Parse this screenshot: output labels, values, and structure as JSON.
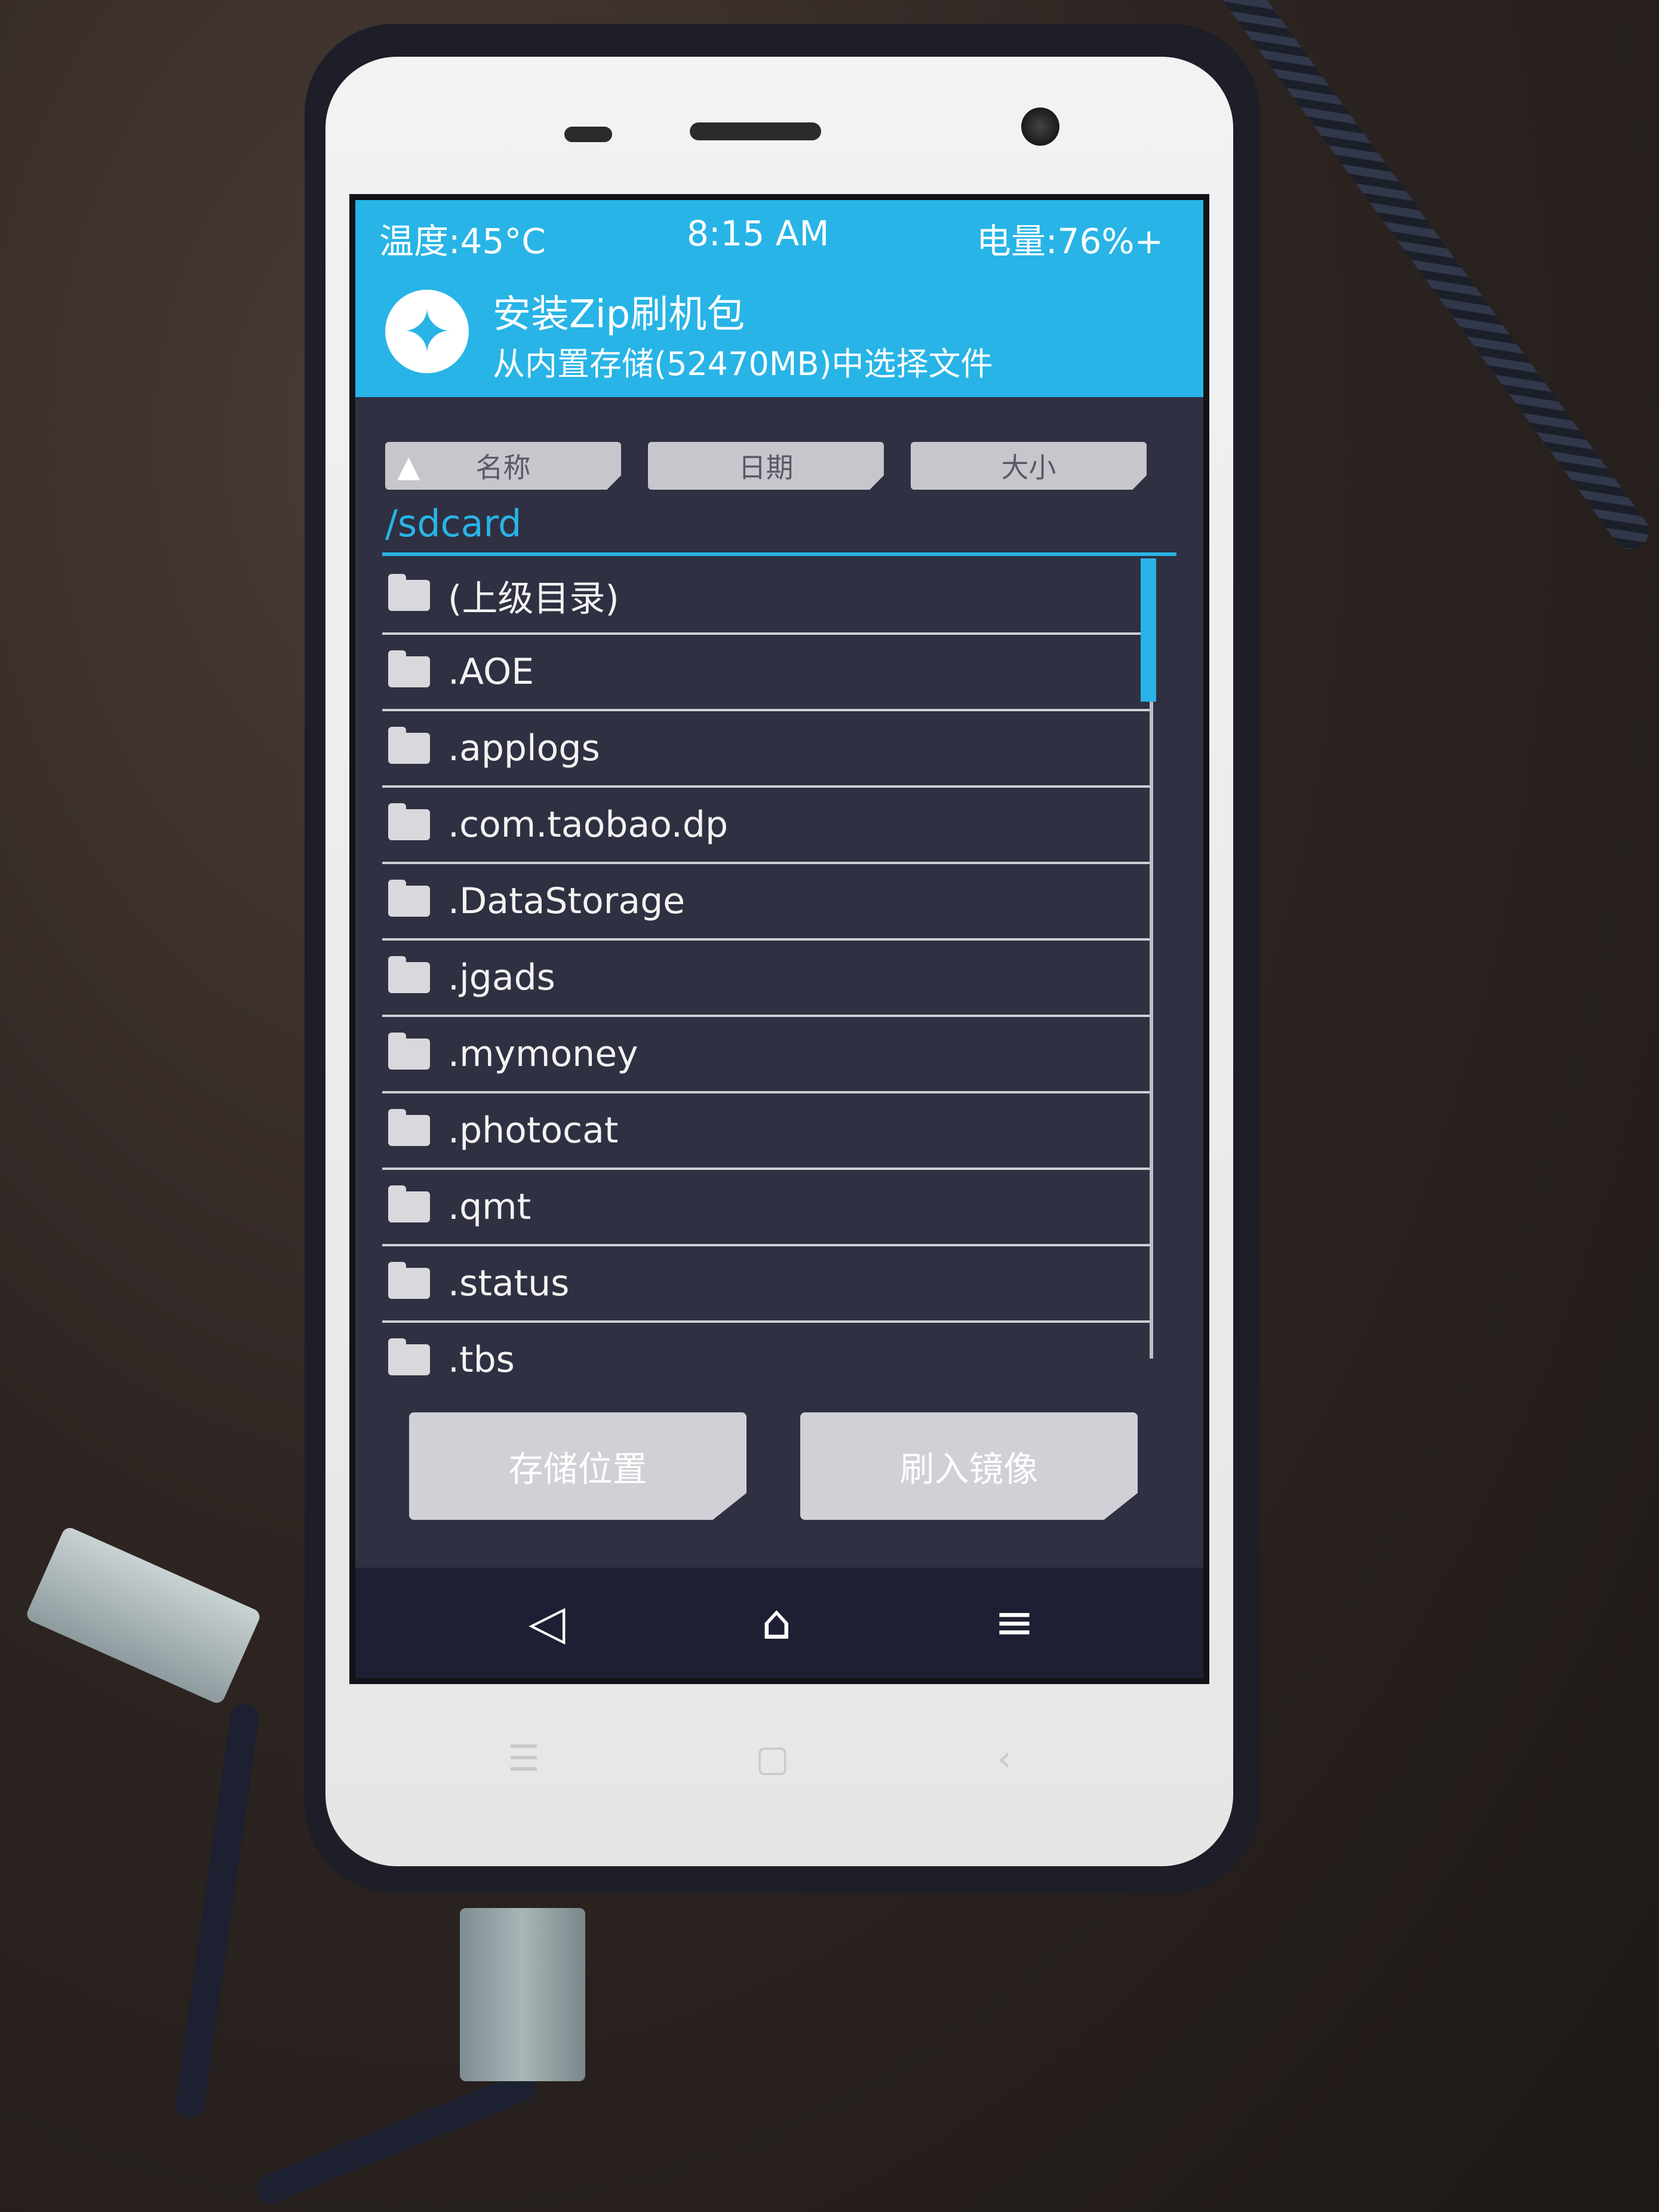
{
  "status": {
    "temperature": "温度:45°C",
    "time": "8:15 AM",
    "battery": "电量:76%+"
  },
  "header": {
    "title": "安装Zip刷机包",
    "subtitle": "从内置存储(52470MB)中选择文件"
  },
  "sort": {
    "name": "名称",
    "date": "日期",
    "size": "大小"
  },
  "path": "/sdcard",
  "files": [
    {
      "name": "(上级目录)"
    },
    {
      "name": ".AOE"
    },
    {
      "name": ".applogs"
    },
    {
      "name": ".com.taobao.dp"
    },
    {
      "name": ".DataStorage"
    },
    {
      "name": ".jgads"
    },
    {
      "name": ".mymoney"
    },
    {
      "name": ".photocat"
    },
    {
      "name": ".qmt"
    },
    {
      "name": ".status"
    },
    {
      "name": ".tbs"
    }
  ],
  "actions": {
    "storage": "存储位置",
    "flash_image": "刷入镜像"
  },
  "icons": {
    "logo": "twrp-logo-icon",
    "sort_arrow": "triangle-up-icon",
    "folder": "folder-icon",
    "nav_back": "back-triangle-icon",
    "nav_home": "home-icon",
    "nav_menu": "menu-lines-icon"
  },
  "colors": {
    "accent": "#28b4e6",
    "background": "#2f3041",
    "button": "#d0d0d6"
  }
}
